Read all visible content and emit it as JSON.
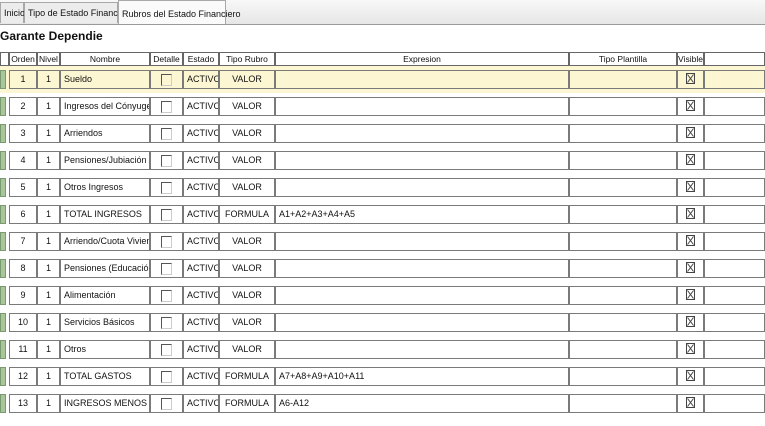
{
  "tabs": [
    {
      "label": "Inicio",
      "active": false
    },
    {
      "label": "Tipo de Estado Financiero",
      "active": false
    },
    {
      "label": "Rubros del Estado Financiero",
      "active": true
    }
  ],
  "title": "Garante Dependie",
  "columns": {
    "orden": "Orden",
    "nivel": "Nivel",
    "nombre": "Nombre",
    "detalle": "Detalle",
    "estado": "Estado",
    "tipo_rubro": "Tipo Rubro",
    "expresion": "Expresion",
    "tipo_plantilla": "Tipo Plantilla",
    "visible": "Visible"
  },
  "rows": [
    {
      "orden": "1",
      "nivel": "1",
      "nombre": "Sueldo",
      "estado": "ACTIVO",
      "tipo_rubro": "VALOR",
      "expresion": "",
      "selected": true
    },
    {
      "orden": "2",
      "nivel": "1",
      "nombre": "Ingresos del Cónyuge",
      "estado": "ACTIVO",
      "tipo_rubro": "VALOR",
      "expresion": ""
    },
    {
      "orden": "3",
      "nivel": "1",
      "nombre": "Arriendos",
      "estado": "ACTIVO",
      "tipo_rubro": "VALOR",
      "expresion": ""
    },
    {
      "orden": "4",
      "nivel": "1",
      "nombre": "Pensiones/Jubiación",
      "estado": "ACTIVO",
      "tipo_rubro": "VALOR",
      "expresion": ""
    },
    {
      "orden": "5",
      "nivel": "1",
      "nombre": "Otros Ingresos",
      "estado": "ACTIVO",
      "tipo_rubro": "VALOR",
      "expresion": ""
    },
    {
      "orden": "6",
      "nivel": "1",
      "nombre": "TOTAL INGRESOS",
      "estado": "ACTIVO",
      "tipo_rubro": "FORMULA",
      "expresion": "A1+A2+A3+A4+A5"
    },
    {
      "orden": "7",
      "nivel": "1",
      "nombre": "Arriendo/Cuota Vivienda",
      "estado": "ACTIVO",
      "tipo_rubro": "VALOR",
      "expresion": ""
    },
    {
      "orden": "8",
      "nivel": "1",
      "nombre": "Pensiones (Educación)",
      "estado": "ACTIVO",
      "tipo_rubro": "VALOR",
      "expresion": ""
    },
    {
      "orden": "9",
      "nivel": "1",
      "nombre": "Alimentación",
      "estado": "ACTIVO",
      "tipo_rubro": "VALOR",
      "expresion": ""
    },
    {
      "orden": "10",
      "nivel": "1",
      "nombre": "Servicios Básicos",
      "estado": "ACTIVO",
      "tipo_rubro": "VALOR",
      "expresion": ""
    },
    {
      "orden": "11",
      "nivel": "1",
      "nombre": "Otros",
      "estado": "ACTIVO",
      "tipo_rubro": "VALOR",
      "expresion": ""
    },
    {
      "orden": "12",
      "nivel": "1",
      "nombre": "TOTAL GASTOS",
      "estado": "ACTIVO",
      "tipo_rubro": "FORMULA",
      "expresion": "A7+A8+A9+A10+A11"
    },
    {
      "orden": "13",
      "nivel": "1",
      "nombre": "INGRESOS MENOS GAST",
      "estado": "ACTIVO",
      "tipo_rubro": "FORMULA",
      "expresion": "A6-A12"
    }
  ],
  "colors": {
    "selected_row": "#fdf6d2",
    "row_marker": "#a7c79a"
  }
}
